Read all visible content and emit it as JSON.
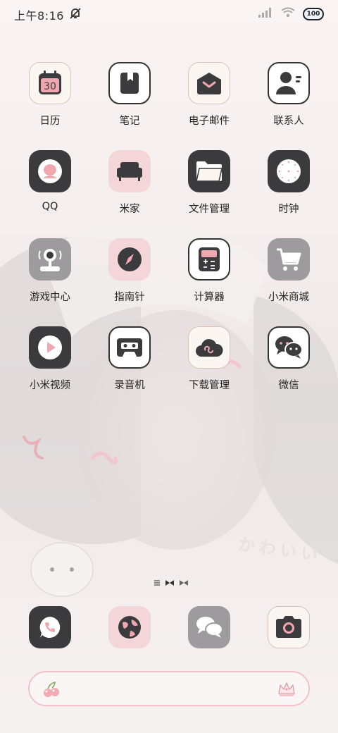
{
  "status_bar": {
    "time": "上午8:16",
    "battery": "100"
  },
  "apps": [
    {
      "label": "日历",
      "icon": "calendar-icon",
      "day": "30"
    },
    {
      "label": "笔记",
      "icon": "notebook-icon"
    },
    {
      "label": "电子邮件",
      "icon": "mail-icon"
    },
    {
      "label": "联系人",
      "icon": "contacts-icon"
    },
    {
      "label": "QQ",
      "icon": "qq-icon"
    },
    {
      "label": "米家",
      "icon": "sofa-icon"
    },
    {
      "label": "文件管理",
      "icon": "folder-icon"
    },
    {
      "label": "时钟",
      "icon": "clock-icon"
    },
    {
      "label": "游戏中心",
      "icon": "joystick-icon"
    },
    {
      "label": "指南针",
      "icon": "compass-icon"
    },
    {
      "label": "计算器",
      "icon": "calculator-icon"
    },
    {
      "label": "小米商城",
      "icon": "cart-icon"
    },
    {
      "label": "小米视频",
      "icon": "play-icon"
    },
    {
      "label": "录音机",
      "icon": "cassette-icon"
    },
    {
      "label": "下载管理",
      "icon": "cloud-icon"
    },
    {
      "label": "微信",
      "icon": "chat-bubbles-icon"
    }
  ],
  "dock": [
    {
      "icon": "phone-icon"
    },
    {
      "icon": "globe-icon"
    },
    {
      "icon": "messages-icon"
    },
    {
      "icon": "camera-icon"
    }
  ],
  "wallpaper_text": "かわいい",
  "colors": {
    "tile_dark": "#3b3a3c",
    "tile_pink": "#f4d6d8",
    "accent_pink": "#e89aa3",
    "tile_gray": "#9d9b9d"
  }
}
